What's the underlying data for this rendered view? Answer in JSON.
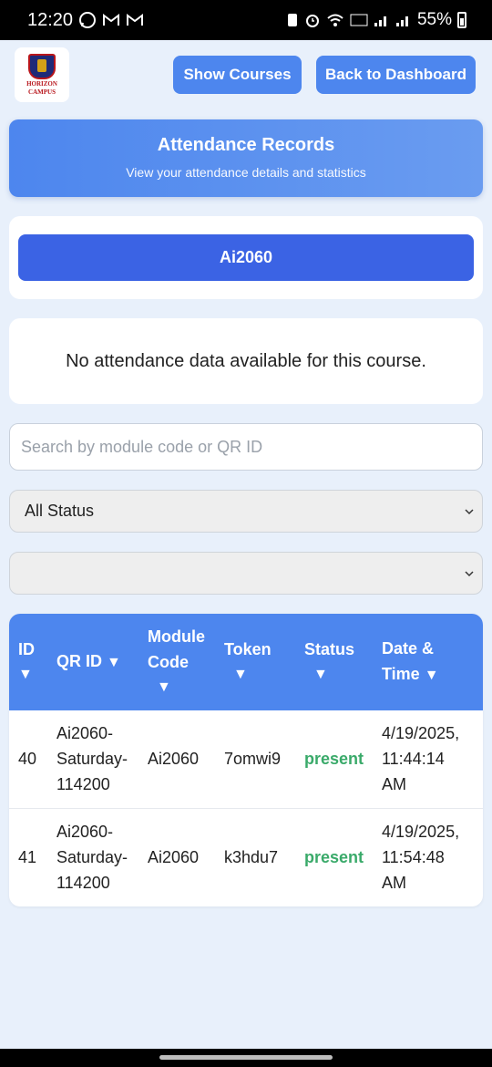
{
  "status_bar": {
    "time": "12:20",
    "battery": "55%"
  },
  "header": {
    "logo_text_1": "HORIZON",
    "logo_text_2": "CAMPUS",
    "show_courses": "Show Courses",
    "back_dashboard": "Back to Dashboard"
  },
  "hero": {
    "title": "Attendance Records",
    "subtitle": "View your attendance details and statistics"
  },
  "course": {
    "selected": "Ai2060"
  },
  "nodata": "No attendance data available for this course.",
  "filters": {
    "search_placeholder": "Search by module code or QR ID",
    "status_value": "All Status",
    "second_value": ""
  },
  "table": {
    "headers": {
      "id": "ID",
      "qr": "QR ID",
      "module_1": "Module",
      "module_2": "Code",
      "token": "Token",
      "status": "Status",
      "date_1": "Date &",
      "date_2": "Time",
      "sort": "▼"
    },
    "rows": [
      {
        "id": "40",
        "qr_1": "Ai2060-",
        "qr_2": "Saturday-",
        "qr_3": "114200",
        "module": "Ai2060",
        "token": "7omwi9",
        "status": "present",
        "date_1": "4/19/2025,",
        "date_2": "11:44:14",
        "date_3": "AM"
      },
      {
        "id": "41",
        "qr_1": "Ai2060-",
        "qr_2": "Saturday-",
        "qr_3": "114200",
        "module": "Ai2060",
        "token": "k3hdu7",
        "status": "present",
        "date_1": "4/19/2025,",
        "date_2": "11:54:48",
        "date_3": "AM"
      }
    ]
  },
  "colors": {
    "primary": "#4d86ee",
    "course_button": "#3b63e4",
    "present": "#3aaa6a",
    "background": "#e8f0fb"
  }
}
